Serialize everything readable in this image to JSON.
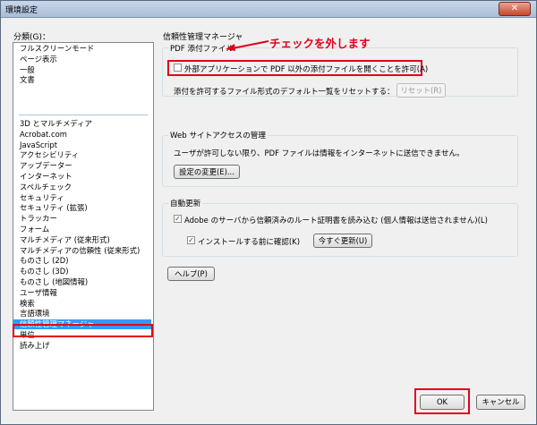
{
  "window": {
    "title": "環境設定",
    "close_icon": "close-icon"
  },
  "categories": {
    "label": "分類(G)：",
    "items": [
      "フルスクリーンモード",
      "ページ表示",
      "一般",
      "文書",
      "3D とマルチメディア",
      "Acrobat.com",
      "JavaScript",
      "アクセシビリティ",
      "アップデーター",
      "インターネット",
      "スペルチェック",
      "セキュリティ",
      "セキュリティ (拡張)",
      "トラッカー",
      "フォーム",
      "マルチメディア (従来形式)",
      "マルチメディアの信頼性 (従来形式)",
      "ものさし (2D)",
      "ものさし (3D)",
      "ものさし (地図情報)",
      "ユーザ情報",
      "検索",
      "言語環境",
      "信頼性管理マネージャ",
      "単位",
      "読み上げ"
    ],
    "selected": "信頼性管理マネージャ"
  },
  "panel": {
    "title": "信頼性管理マネージャ",
    "pdf_group": {
      "label": "PDF 添付ファイル",
      "checkbox_label": "外部アプリケーションで PDF 以外の添付ファイルを開くことを許可(A)",
      "checked": false,
      "reset_text": "添付を許可するファイル形式のデフォルト一覧をリセットする：",
      "reset_button": "リセット(R)"
    },
    "web_group": {
      "label": "Web サイトアクセスの管理",
      "desc": "ユーザが許可しない限り、PDF ファイルは情報をインターネットに送信できません。",
      "change_button": "設定の変更(E)..."
    },
    "update_group": {
      "label": "自動更新",
      "checkbox1_label": "Adobe のサーバから信頼済みのルート証明書を読み込む (個人情報は送信されません)(L)",
      "checkbox1_checked": true,
      "checkbox2_label": "インストールする前に確認(K)",
      "checkbox2_checked": true,
      "update_button": "今すぐ更新(U)"
    },
    "help_button": "ヘルプ(P)"
  },
  "annotation": {
    "text": "チェックを外します",
    "color": "#e2001a"
  },
  "footer": {
    "ok_button": "OK",
    "cancel_button": "キャンセル"
  }
}
